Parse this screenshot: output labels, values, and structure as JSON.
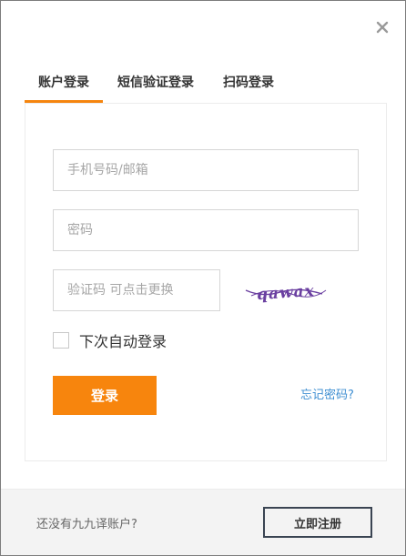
{
  "tabs": [
    {
      "label": "账户登录",
      "active": true
    },
    {
      "label": "短信验证登录",
      "active": false
    },
    {
      "label": "扫码登录",
      "active": false
    }
  ],
  "form": {
    "phone_placeholder": "手机号码/邮箱",
    "password_placeholder": "密码",
    "captcha_placeholder": "验证码 可点击更换",
    "captcha_text": "qawax",
    "remember_label": "下次自动登录",
    "remember_checked": false,
    "login_label": "登录",
    "forgot_label": "忘记密码?"
  },
  "footer": {
    "prompt": "还没有九九译账户?",
    "register_label": "立即注册"
  },
  "colors": {
    "accent": "#f7850d",
    "link": "#3f8fd2",
    "captcha": "#6a3fa0"
  },
  "icons": {
    "close": "close-icon"
  }
}
